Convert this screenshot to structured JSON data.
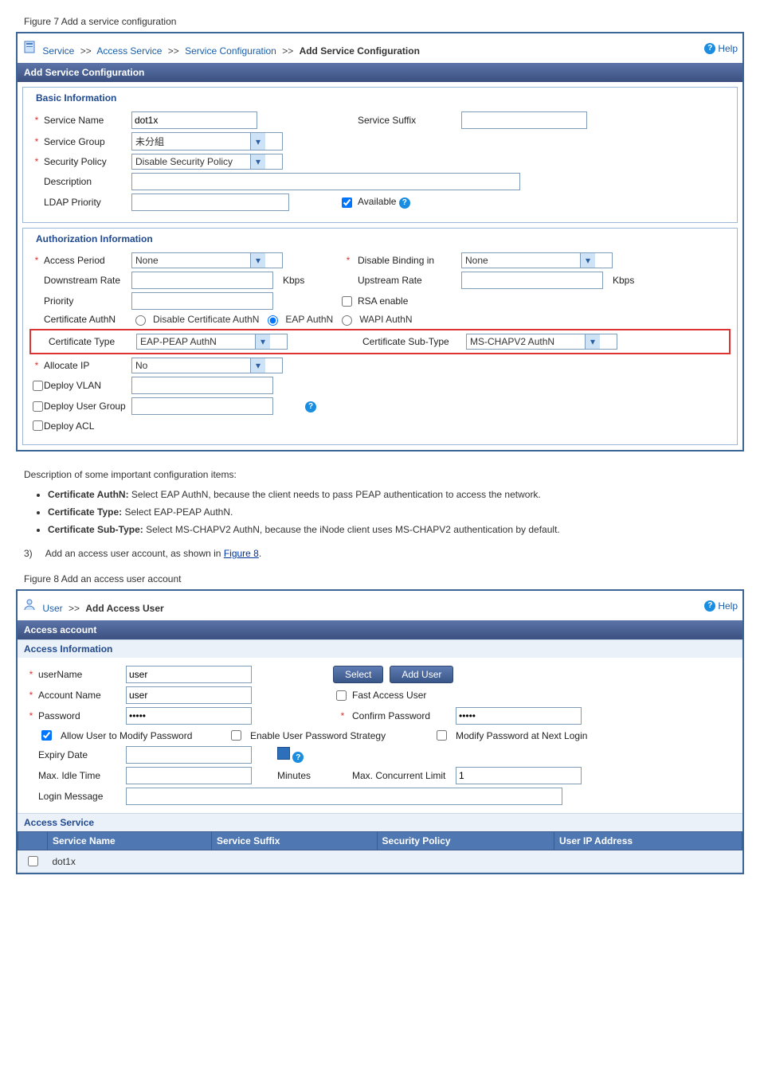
{
  "fig1": {
    "caption": "Figure 7 Add a service configuration",
    "breadcrumb": {
      "p1": "Service",
      "p2": "Access Service",
      "p3": "Service Configuration",
      "p4": "Add Service Configuration",
      "help": "Help"
    },
    "title_bar": "Add Service Configuration",
    "basic": {
      "legend": "Basic Information",
      "rows": {
        "service_name": {
          "label": "Service Name",
          "value": "dot1x"
        },
        "service_suffix": {
          "label": "Service Suffix",
          "value": ""
        },
        "service_group": {
          "label": "Service Group",
          "value": "未分組"
        },
        "security_policy": {
          "label": "Security Policy",
          "value": "Disable Security Policy"
        },
        "description": {
          "label": "Description",
          "value": ""
        },
        "ldap_priority": {
          "label": "LDAP Priority",
          "value": ""
        },
        "available": {
          "label": "Available",
          "checked": true
        }
      }
    },
    "auth": {
      "legend": "Authorization Information",
      "rows": {
        "access_period": {
          "label": "Access Period",
          "value": "None"
        },
        "disable_binding": {
          "label": "Disable Binding in",
          "value": "None"
        },
        "downstream": {
          "label": "Downstream Rate",
          "value": "",
          "unit": "Kbps"
        },
        "upstream": {
          "label": "Upstream Rate",
          "value": "",
          "unit": "Kbps"
        },
        "priority": {
          "label": "Priority",
          "value": ""
        },
        "rsa": {
          "label": "RSA enable",
          "checked": false
        },
        "cert_authn": {
          "label": "Certificate AuthN",
          "opts": {
            "disable": "Disable Certificate AuthN",
            "eap": "EAP AuthN",
            "wapi": "WAPI AuthN"
          },
          "selected": "eap"
        },
        "cert_type": {
          "label": "Certificate Type",
          "value": "EAP-PEAP AuthN"
        },
        "cert_sub": {
          "label": "Certificate Sub-Type",
          "value": "MS-CHAPV2 AuthN"
        },
        "allocate_ip": {
          "label": "Allocate IP",
          "value": "No"
        },
        "deploy_vlan": {
          "label": "Deploy VLAN",
          "checked": false,
          "value": ""
        },
        "deploy_ug": {
          "label": "Deploy User Group",
          "checked": false,
          "value": ""
        },
        "deploy_acl": {
          "label": "Deploy ACL",
          "checked": false
        }
      }
    }
  },
  "midtext": {
    "para": "Description of some important configuration items:",
    "bullets": {
      "b1_lbl": "Certificate AuthN:",
      "b1_txt": " Select EAP AuthN, because the client needs to pass PEAP authentication to access the network.",
      "b2_lbl": "Certificate Type:",
      "b2_txt": " Select EAP-PEAP AuthN.",
      "b3_lbl": "Certificate Sub-Type:",
      "b3_txt": " Select MS-CHAPV2 AuthN, because the iNode client uses MS-CHAPV2 authentication by default."
    },
    "step_no": "3)",
    "step_txt": "Add an access user account, as shown in ",
    "step_link": "Figure 8",
    "step_tail": "."
  },
  "fig2": {
    "caption": "Figure 8 Add an access user account",
    "breadcrumb": {
      "p1": "User",
      "p2": "Add Access User",
      "help": "Help"
    },
    "title_bar": "Access account",
    "section1": "Access Information",
    "rows": {
      "username": {
        "label": "userName",
        "value": "user",
        "btn_select": "Select",
        "btn_add": "Add User"
      },
      "account": {
        "label": "Account Name",
        "value": "user",
        "fast": {
          "label": "Fast Access User",
          "checked": false
        }
      },
      "password": {
        "label": "Password",
        "value": "•••••",
        "confirm_label": "Confirm Password",
        "confirm_value": "•••••"
      },
      "pw_opts": {
        "allow": {
          "label": "Allow User to Modify Password",
          "checked": true
        },
        "strategy": {
          "label": "Enable User Password Strategy",
          "checked": false
        },
        "next_login": {
          "label": "Modify Password at Next Login",
          "checked": false
        }
      },
      "expiry": {
        "label": "Expiry Date",
        "value": ""
      },
      "idle": {
        "label": "Max. Idle Time",
        "value": "",
        "unit": "Minutes"
      },
      "concurrent": {
        "label": "Max. Concurrent Limit",
        "value": "1"
      },
      "login_msg": {
        "label": "Login Message",
        "value": ""
      }
    },
    "section2": "Access Service",
    "table": {
      "headers": {
        "c1": "Service Name",
        "c2": "Service Suffix",
        "c3": "Security Policy",
        "c4": "User IP Address"
      },
      "rows": [
        {
          "checked": false,
          "name": "dot1x",
          "suffix": "",
          "policy": "",
          "ip": ""
        }
      ]
    }
  }
}
